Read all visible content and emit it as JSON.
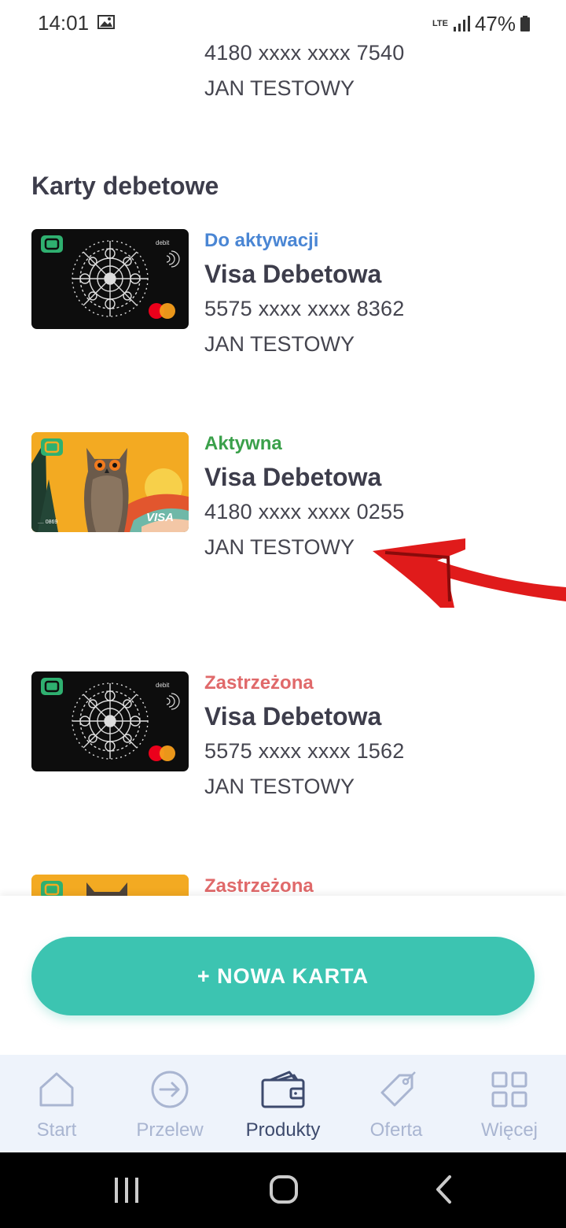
{
  "status_bar": {
    "time": "14:01",
    "network": "LTE",
    "battery": "47%",
    "icons": [
      "image-icon",
      "signal-icon",
      "battery-icon"
    ]
  },
  "top_card": {
    "number": "4180 xxxx xxxx 7540",
    "holder": "JAN TESTOWY"
  },
  "section_title": "Karty debetowe",
  "cards": [
    {
      "status": "Do aktywacji",
      "status_color": "#4a86d4",
      "name": "Visa Debetowa",
      "number": "5575 xxxx xxxx 8362",
      "holder": "JAN TESTOWY",
      "design": "black-debit",
      "card_label": "debit"
    },
    {
      "status": "Aktywna",
      "status_color": "#3aa04a",
      "name": "Visa Debetowa",
      "number": "4180 xxxx xxxx 0255",
      "holder": "JAN TESTOWY",
      "design": "owl-visa",
      "card_label": "VISA",
      "card_suffix": ".... 0869"
    },
    {
      "status": "Zastrzeżona",
      "status_color": "#e0696a",
      "name": "Visa Debetowa",
      "number": "5575 xxxx xxxx 1562",
      "holder": "JAN TESTOWY",
      "design": "black-debit",
      "card_label": "debit"
    },
    {
      "status": "Zastrzeżona",
      "status_color": "#e0696a",
      "design": "owl-visa"
    }
  ],
  "new_card_button": "+ NOWA KARTA",
  "bottom_nav": [
    {
      "label": "Start",
      "icon": "home-icon",
      "active": false
    },
    {
      "label": "Przelew",
      "icon": "transfer-arrow-icon",
      "active": false
    },
    {
      "label": "Produkty",
      "icon": "wallet-icon",
      "active": true
    },
    {
      "label": "Oferta",
      "icon": "tag-icon",
      "active": false
    },
    {
      "label": "Więcej",
      "icon": "grid-icon",
      "active": false
    }
  ],
  "system_nav": [
    "recents-icon",
    "home-button-icon",
    "back-icon"
  ],
  "colors": {
    "accent": "#3cc4b1",
    "arrow": "#e01b1b"
  }
}
